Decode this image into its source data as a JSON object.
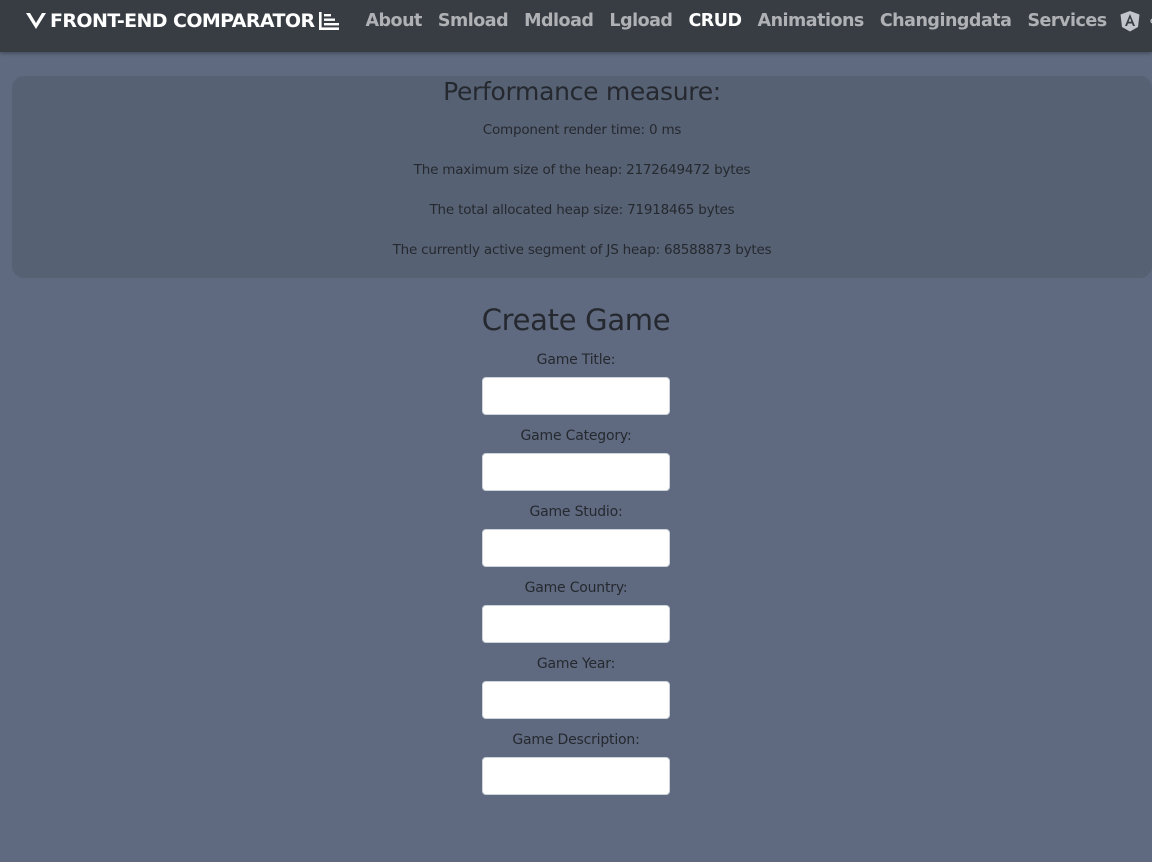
{
  "navbar": {
    "brand": "FRONT-END COMPARATOR",
    "links": [
      {
        "label": "About",
        "active": false
      },
      {
        "label": "Smload",
        "active": false
      },
      {
        "label": "Mdload",
        "active": false
      },
      {
        "label": "Lgload",
        "active": false
      },
      {
        "label": "CRUD",
        "active": true
      },
      {
        "label": "Animations",
        "active": false
      },
      {
        "label": "Changingdata",
        "active": false
      },
      {
        "label": "Services",
        "active": false
      }
    ],
    "framework_icons": [
      "angular-icon",
      "react-icon",
      "vue-icon"
    ]
  },
  "performance": {
    "title": "Performance measure:",
    "render_time": "Component render time: 0 ms",
    "heap_max": "The maximum size of the heap: 2172649472 bytes",
    "heap_total": "The total allocated heap size: 71918465 bytes",
    "heap_active": "The currently active segment of JS heap: 68588873 bytes"
  },
  "form": {
    "title": "Create Game",
    "fields": [
      {
        "label": "Game Title:",
        "value": ""
      },
      {
        "label": "Game Category:",
        "value": ""
      },
      {
        "label": "Game Studio:",
        "value": ""
      },
      {
        "label": "Game Country:",
        "value": ""
      },
      {
        "label": "Game Year:",
        "value": ""
      },
      {
        "label": "Game Description:",
        "value": ""
      }
    ]
  },
  "colors": {
    "page_background": "#5f6a80",
    "navbar_background": "#383d44",
    "card_background": "#566173",
    "text_dark": "#25292f",
    "input_background": "#ffffff"
  }
}
